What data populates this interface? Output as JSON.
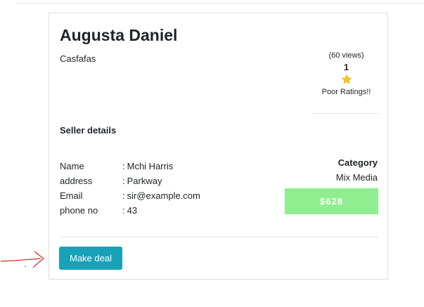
{
  "listing": {
    "title": "Augusta Daniel",
    "subtitle": "Casfafas"
  },
  "rating": {
    "views": "(60 views)",
    "count": "1",
    "verdict": "Poor Ratings!!",
    "icon": "star-icon",
    "star_color": "#f5c518"
  },
  "seller": {
    "heading": "Seller details",
    "rows": [
      {
        "label": "Name",
        "sep": ":",
        "value": "Mchi Harris"
      },
      {
        "label": "address",
        "sep": ":",
        "value": "Parkway"
      },
      {
        "label": "Email",
        "sep": ":",
        "value": "sir@example.com"
      },
      {
        "label": "phone no",
        "sep": ":",
        "value": "43"
      }
    ]
  },
  "category": {
    "heading": "Category",
    "value": "Mix Media"
  },
  "price": {
    "label": "$628",
    "background": "#90ee90"
  },
  "actions": {
    "make_deal_label": "Make deal",
    "button_color": "#17a2b8"
  },
  "annotation": {
    "icon": "arrow-right-icon",
    "color": "#d32f2f"
  }
}
